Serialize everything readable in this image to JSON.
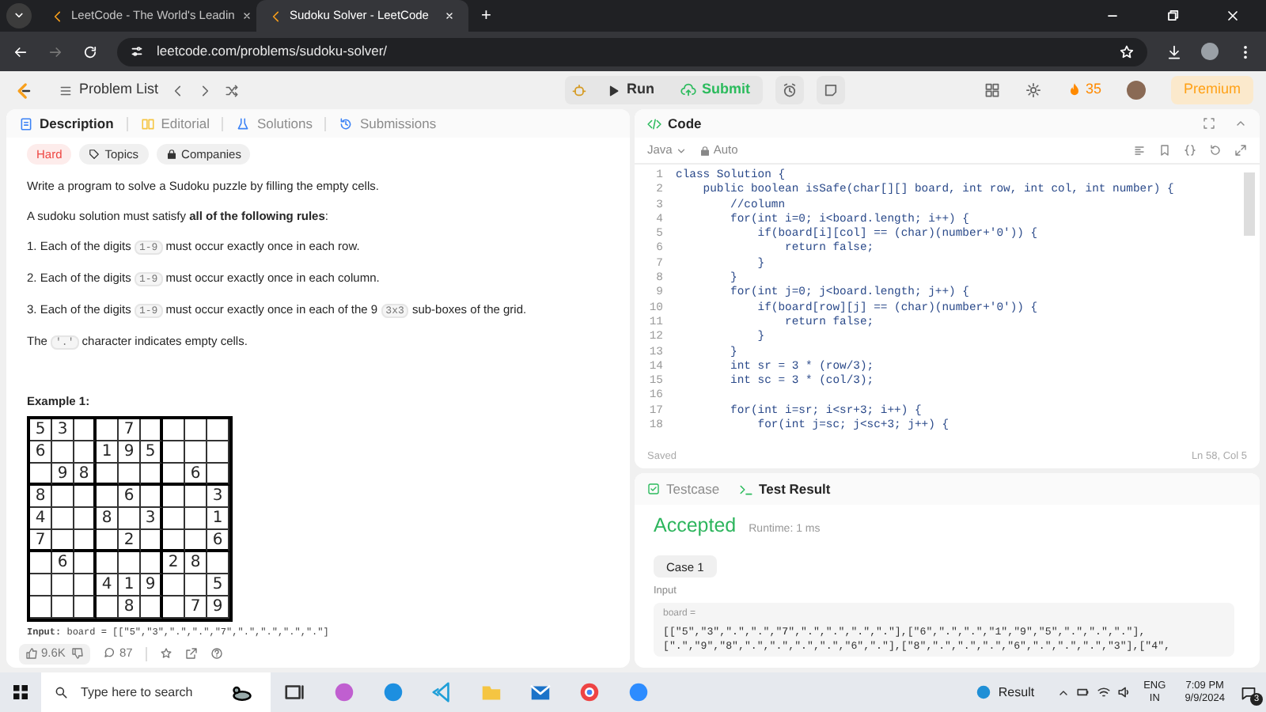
{
  "browser": {
    "tabs": [
      {
        "title": "LeetCode - The World's Leadin",
        "selected": false
      },
      {
        "title": "Sudoku Solver - LeetCode",
        "selected": true
      }
    ],
    "new_tab": "+",
    "url": "leetcode.com/problems/sudoku-solver/"
  },
  "header": {
    "problem_list": "Problem List",
    "run": "Run",
    "submit": "Submit",
    "streak": "35",
    "premium": "Premium"
  },
  "description_panel": {
    "tabs": [
      {
        "label": "Description",
        "selected": true
      },
      {
        "label": "Editorial",
        "selected": false
      },
      {
        "label": "Solutions",
        "selected": false
      },
      {
        "label": "Submissions",
        "selected": false
      }
    ],
    "badges": [
      {
        "kind": "difficulty",
        "label": "Hard"
      },
      {
        "kind": "topics",
        "label": "Topics"
      },
      {
        "kind": "companies",
        "label": "Companies"
      }
    ],
    "paragraphs": [
      [
        {
          "kind": "text",
          "text": "Write a program to solve a Sudoku puzzle by filling the empty cells."
        }
      ],
      [
        {
          "kind": "text",
          "text": "A sudoku solution must satisfy **all of the following rules**:"
        }
      ],
      [
        {
          "kind": "text",
          "text": "1. Each of the digits "
        },
        {
          "kind": "code",
          "text": "1-9"
        },
        {
          "kind": "text",
          "text": " must occur exactly once in each row."
        }
      ],
      [
        {
          "kind": "text",
          "text": "2. Each of the digits "
        },
        {
          "kind": "code",
          "text": "1-9"
        },
        {
          "kind": "text",
          "text": " must occur exactly once in each column."
        }
      ],
      [
        {
          "kind": "text",
          "text": "3. Each of the digits "
        },
        {
          "kind": "code",
          "text": "1-9"
        },
        {
          "kind": "text",
          "text": " must occur exactly once in each of the 9 "
        },
        {
          "kind": "code",
          "text": "3x3"
        },
        {
          "kind": "text",
          "text": " sub-boxes of the grid."
        }
      ],
      [
        {
          "kind": "text",
          "text": "The "
        },
        {
          "kind": "code",
          "text": "'.'"
        },
        {
          "kind": "text",
          "text": " character indicates empty cells."
        }
      ]
    ],
    "example_title": "Example 1:",
    "sudoku": [
      [
        {
          "kind": "given",
          "digit": "5"
        },
        {
          "kind": "given",
          "digit": "3"
        },
        {
          "kind": "empty"
        },
        {
          "kind": "empty"
        },
        {
          "kind": "given",
          "digit": "7"
        },
        {
          "kind": "empty"
        },
        {
          "kind": "empty"
        },
        {
          "kind": "empty"
        },
        {
          "kind": "empty"
        }
      ],
      [
        {
          "kind": "given",
          "digit": "6"
        },
        {
          "kind": "empty"
        },
        {
          "kind": "empty"
        },
        {
          "kind": "given",
          "digit": "1"
        },
        {
          "kind": "given",
          "digit": "9"
        },
        {
          "kind": "given",
          "digit": "5"
        },
        {
          "kind": "empty"
        },
        {
          "kind": "empty"
        },
        {
          "kind": "empty"
        }
      ],
      [
        {
          "kind": "empty"
        },
        {
          "kind": "given",
          "digit": "9"
        },
        {
          "kind": "given",
          "digit": "8"
        },
        {
          "kind": "empty"
        },
        {
          "kind": "empty"
        },
        {
          "kind": "empty"
        },
        {
          "kind": "empty"
        },
        {
          "kind": "given",
          "digit": "6"
        },
        {
          "kind": "empty"
        }
      ],
      [
        {
          "kind": "given",
          "digit": "8"
        },
        {
          "kind": "empty"
        },
        {
          "kind": "empty"
        },
        {
          "kind": "empty"
        },
        {
          "kind": "given",
          "digit": "6"
        },
        {
          "kind": "empty"
        },
        {
          "kind": "empty"
        },
        {
          "kind": "empty"
        },
        {
          "kind": "given",
          "digit": "3"
        }
      ],
      [
        {
          "kind": "given",
          "digit": "4"
        },
        {
          "kind": "empty"
        },
        {
          "kind": "empty"
        },
        {
          "kind": "given",
          "digit": "8"
        },
        {
          "kind": "empty"
        },
        {
          "kind": "given",
          "digit": "3"
        },
        {
          "kind": "empty"
        },
        {
          "kind": "empty"
        },
        {
          "kind": "given",
          "digit": "1"
        }
      ],
      [
        {
          "kind": "given",
          "digit": "7"
        },
        {
          "kind": "empty"
        },
        {
          "kind": "empty"
        },
        {
          "kind": "empty"
        },
        {
          "kind": "given",
          "digit": "2"
        },
        {
          "kind": "empty"
        },
        {
          "kind": "empty"
        },
        {
          "kind": "empty"
        },
        {
          "kind": "given",
          "digit": "6"
        }
      ],
      [
        {
          "kind": "empty"
        },
        {
          "kind": "given",
          "digit": "6"
        },
        {
          "kind": "empty"
        },
        {
          "kind": "empty"
        },
        {
          "kind": "empty"
        },
        {
          "kind": "empty"
        },
        {
          "kind": "given",
          "digit": "2"
        },
        {
          "kind": "given",
          "digit": "8"
        },
        {
          "kind": "empty"
        }
      ],
      [
        {
          "kind": "empty"
        },
        {
          "kind": "empty"
        },
        {
          "kind": "empty"
        },
        {
          "kind": "given",
          "digit": "4"
        },
        {
          "kind": "given",
          "digit": "1"
        },
        {
          "kind": "given",
          "digit": "9"
        },
        {
          "kind": "empty"
        },
        {
          "kind": "empty"
        },
        {
          "kind": "given",
          "digit": "5"
        }
      ],
      [
        {
          "kind": "empty"
        },
        {
          "kind": "empty"
        },
        {
          "kind": "empty"
        },
        {
          "kind": "empty"
        },
        {
          "kind": "given",
          "digit": "8"
        },
        {
          "kind": "empty"
        },
        {
          "kind": "empty"
        },
        {
          "kind": "given",
          "digit": "7"
        },
        {
          "kind": "given",
          "digit": "9"
        }
      ]
    ],
    "input_label": "Input:",
    "input_value": "board = [[\"5\",\"3\",\".\",\".\",\"7\",\".\",\".\",\".\",\".\"]",
    "likes": "9.6K",
    "comments": "87"
  },
  "code_panel": {
    "title": "Code",
    "language": "Java",
    "mode": "Auto",
    "lines": [
      {
        "number": "1",
        "text": "class Solution {"
      },
      {
        "number": "2",
        "text": "    public boolean isSafe(char[][] board, int row, int col, int number) {"
      },
      {
        "number": "3",
        "text": "        //column"
      },
      {
        "number": "4",
        "text": "        for(int i=0; i<board.length; i++) {"
      },
      {
        "number": "5",
        "text": "            if(board[i][col] == (char)(number+'0')) {"
      },
      {
        "number": "6",
        "text": "                return false;"
      },
      {
        "number": "7",
        "text": "            }"
      },
      {
        "number": "8",
        "text": "        }"
      },
      {
        "number": "9",
        "text": "        for(int j=0; j<board.length; j++) {"
      },
      {
        "number": "10",
        "text": "            if(board[row][j] == (char)(number+'0')) {"
      },
      {
        "number": "11",
        "text": "                return false;"
      },
      {
        "number": "12",
        "text": "            }"
      },
      {
        "number": "13",
        "text": "        }"
      },
      {
        "number": "14",
        "text": "        int sr = 3 * (row/3);"
      },
      {
        "number": "15",
        "text": "        int sc = 3 * (col/3);"
      },
      {
        "number": "16"
      },
      {
        "number": "17",
        "text": "        for(int i=sr; i<sr+3; i++) {"
      },
      {
        "number": "18",
        "text": "            for(int j=sc; j<sc+3; j++) {"
      }
    ],
    "status": "Saved",
    "cursor": "Ln 58, Col 5"
  },
  "result_panel": {
    "tabs": [
      {
        "label": "Testcase",
        "selected": false
      },
      {
        "label": "Test Result",
        "selected": true
      }
    ],
    "verdict": "Accepted",
    "runtime": "Runtime: 1 ms",
    "case": "Case 1",
    "input_label": "Input",
    "param": "board =",
    "value": "[[\"5\",\"3\",\".\",\".\",\"7\",\".\",\".\",\".\",\".\"],[\"6\",\".\",\".\",\"1\",\"9\",\"5\",\".\",\".\",\".\"],[\".\",\"9\",\"8\",\".\",\".\",\".\",\".\",\"6\",\".\"],[\"8\",\".\",\".\",\".\",\"6\",\".\",\".\",\".\",\"3\"],[\"4\","
  },
  "taskbar": {
    "search_placeholder": "Type here to search",
    "weather": "Result",
    "lang": "ENG",
    "region": "IN",
    "time": "7:09 PM",
    "date": "9/9/2024",
    "notifications": "3"
  }
}
